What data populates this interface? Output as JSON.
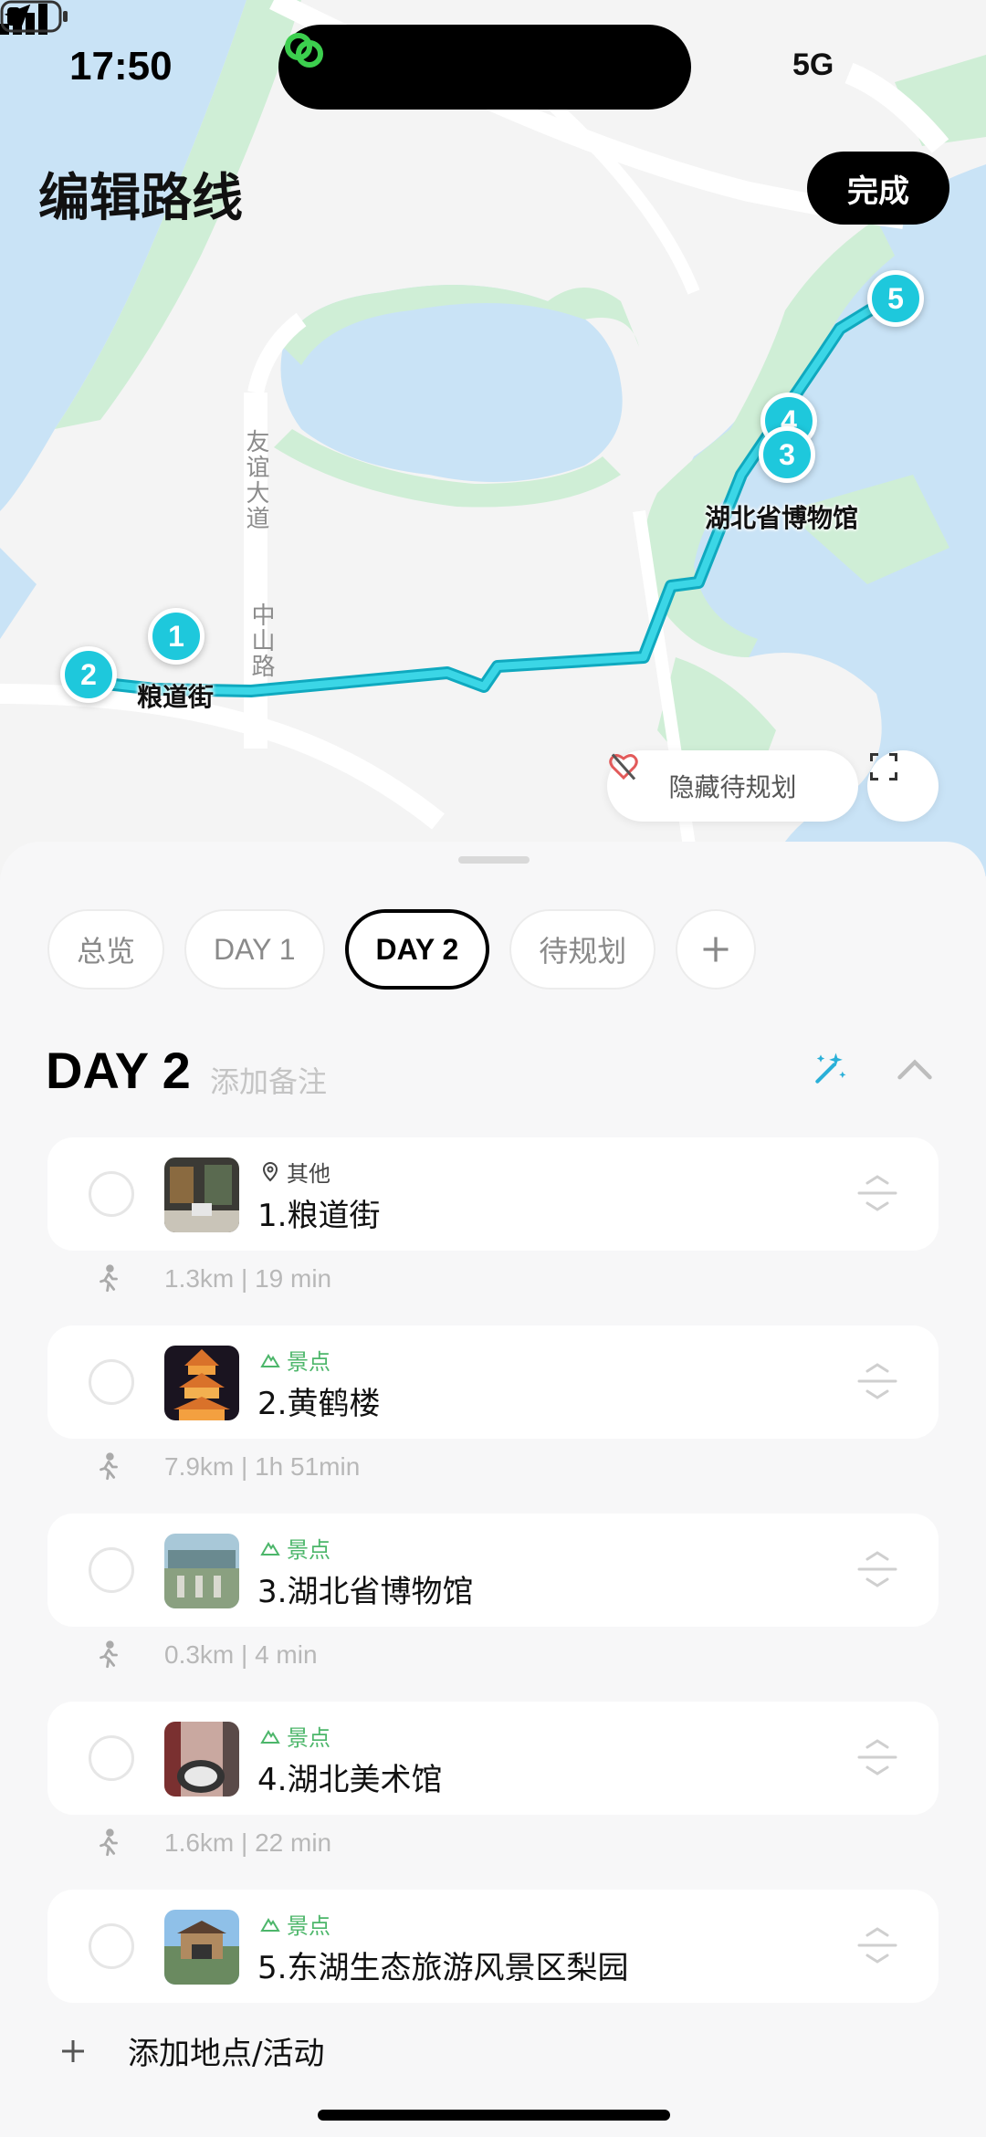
{
  "status_bar": {
    "time": "17:50",
    "network": "5G"
  },
  "header": {
    "title": "编辑路线",
    "done_label": "完成"
  },
  "map": {
    "pins": [
      "1",
      "2",
      "3",
      "4",
      "5"
    ],
    "labels": {
      "liangdao": "粮道街",
      "museum": "湖北省博物馆"
    },
    "roads": {
      "youyi": "友谊大道",
      "zhongshan": "中山路"
    },
    "hide_label": "隐藏待规划"
  },
  "tabs": [
    {
      "label": "总览"
    },
    {
      "label": "DAY 1"
    },
    {
      "label": "DAY 2",
      "active": true
    },
    {
      "label": "待规划"
    }
  ],
  "day": {
    "title": "DAY 2",
    "note_placeholder": "添加备注"
  },
  "places": [
    {
      "category": "其他",
      "name": "1.粮道街",
      "icon": "location-pin-icon"
    },
    {
      "category": "景点",
      "name": "2.黄鹤楼",
      "icon": "mountain-icon"
    },
    {
      "category": "景点",
      "name": "3.湖北省博物馆",
      "icon": "mountain-icon"
    },
    {
      "category": "景点",
      "name": "4.湖北美术馆",
      "icon": "mountain-icon"
    },
    {
      "category": "景点",
      "name": "5.东湖生态旅游风景区梨园",
      "icon": "mountain-icon"
    }
  ],
  "legs": [
    {
      "text": "1.3km | 19 min"
    },
    {
      "text": "7.9km | 1h 51min"
    },
    {
      "text": "0.3km | 4 min"
    },
    {
      "text": "1.6km | 22 min"
    }
  ],
  "add_place_label": "添加地点/活动",
  "colors": {
    "route": "#1ec8dc",
    "sight": "#4cb66a",
    "water": "#c9e3f6",
    "park": "#cfeed6"
  }
}
